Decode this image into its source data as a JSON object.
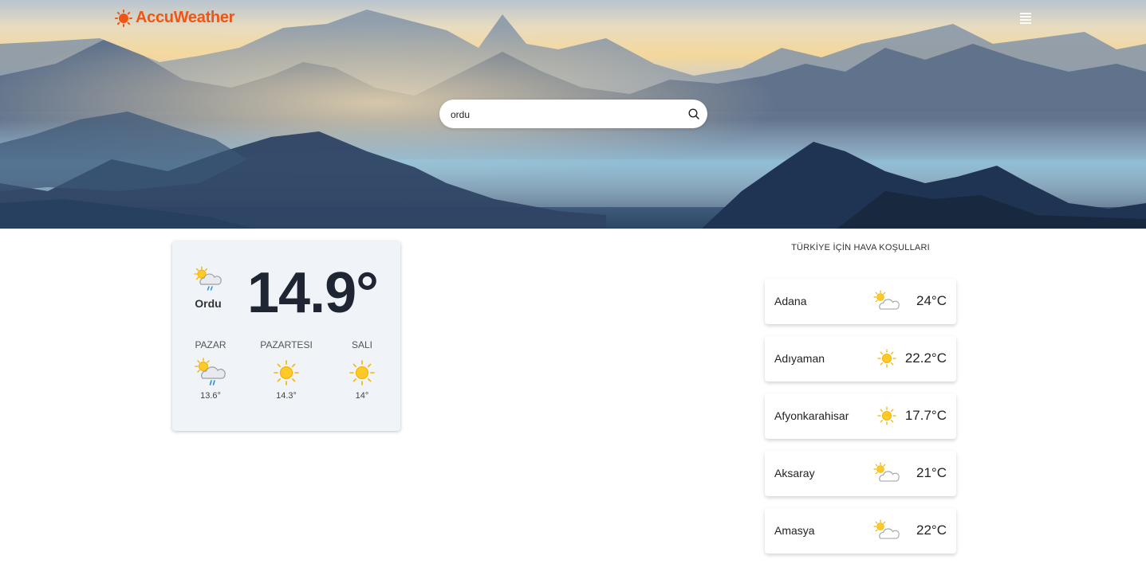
{
  "header": {
    "brand": "AccuWeather",
    "brand_color": "#f05514",
    "logo_icon": "sun-logo-icon",
    "menu_icon": "hamburger-menu-icon"
  },
  "search": {
    "value": "ordu",
    "icon": "search-icon"
  },
  "current": {
    "city": "Ordu",
    "temperature": "14.9°",
    "icon": "partly-sunny-rain-icon",
    "forecast": [
      {
        "day": "PAZAR",
        "temp": "13.6°",
        "icon": "partly-sunny-rain-icon"
      },
      {
        "day": "PAZARTESI",
        "temp": "14.3°",
        "icon": "sun-icon"
      },
      {
        "day": "SALI",
        "temp": "14°",
        "icon": "sun-icon"
      }
    ]
  },
  "conditions": {
    "title": "TÜRKİYE İÇİN HAVA KOŞULLARI",
    "cities": [
      {
        "name": "Adana",
        "temp": "24°C",
        "icon": "partly-cloudy-icon"
      },
      {
        "name": "Adıyaman",
        "temp": "22.2°C",
        "icon": "sun-icon"
      },
      {
        "name": "Afyonkarahisar",
        "temp": "17.7°C",
        "icon": "sun-icon"
      },
      {
        "name": "Aksaray",
        "temp": "21°C",
        "icon": "partly-cloudy-icon"
      },
      {
        "name": "Amasya",
        "temp": "22°C",
        "icon": "partly-cloudy-icon"
      }
    ]
  }
}
